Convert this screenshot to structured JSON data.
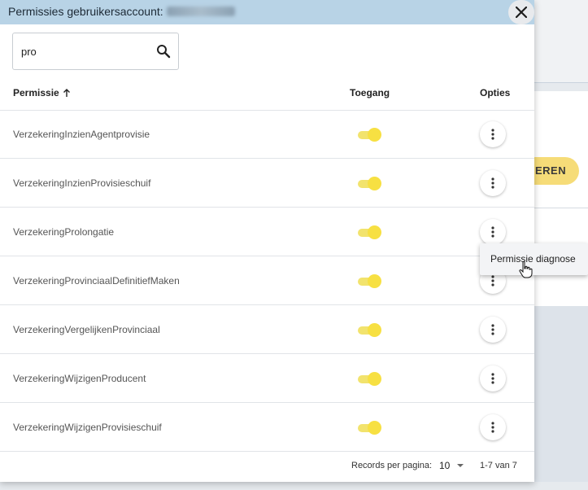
{
  "dialog": {
    "title": "Permissies gebruikersaccount:",
    "close_icon": "close-icon"
  },
  "search": {
    "value": "pro",
    "placeholder": "",
    "icon": "search-icon"
  },
  "table": {
    "headers": {
      "permission": "Permissie",
      "sort_icon": "arrow-up-icon",
      "access": "Toegang",
      "options": "Opties"
    },
    "rows": [
      {
        "name": "VerzekeringInzienAgentprovisie",
        "access": true
      },
      {
        "name": "VerzekeringInzienProvisieschuif",
        "access": true
      },
      {
        "name": "VerzekeringProlongatie",
        "access": true
      },
      {
        "name": "VerzekeringProvinciaalDefinitiefMaken",
        "access": true
      },
      {
        "name": "VerzekeringVergelijkenProvinciaal",
        "access": true
      },
      {
        "name": "VerzekeringWijzigenProducent",
        "access": true
      },
      {
        "name": "VerzekeringWijzigenProvisieschuif",
        "access": true
      }
    ]
  },
  "footer": {
    "records_label": "Records per pagina:",
    "page_size": "10",
    "range": "1-7 van 7"
  },
  "context_menu": {
    "item": "Permissie diagnose"
  },
  "background": {
    "button_label": "EREN"
  },
  "colors": {
    "header_bg": "#b8d3e6",
    "toggle_on": "#f7e042",
    "accent_button": "#f6dc78"
  }
}
